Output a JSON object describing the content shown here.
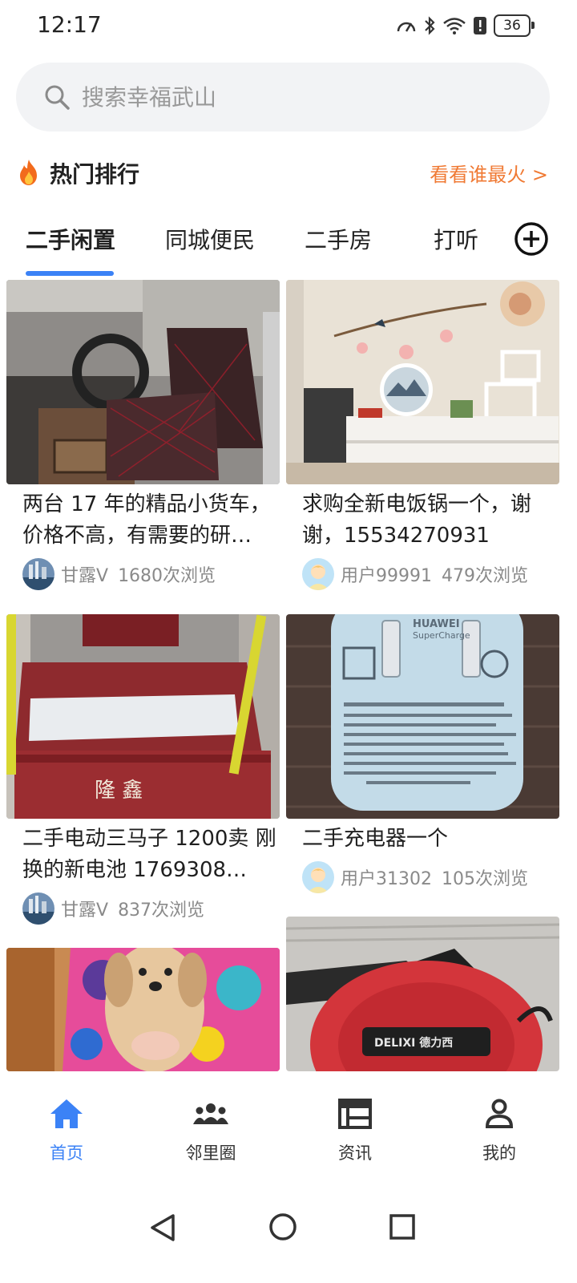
{
  "status": {
    "time": "12:17",
    "battery": "36"
  },
  "search": {
    "placeholder": "搜索幸福武山"
  },
  "hot": {
    "title": "热门排行",
    "link": "看看谁最火 >"
  },
  "tabs": [
    "二手闲置",
    "同城便民",
    "二手房",
    "打听"
  ],
  "cards": [
    {
      "title": "两台 17 年的精品小货车，价格不高，有需要的研…",
      "user": "甘露V",
      "views": "1680次浏览",
      "image": "van-seat-photo",
      "avatar": "city-avatar"
    },
    {
      "title": "求购全新电饭锅一个，谢谢，15534270931",
      "user": "用户99991",
      "views": "479次浏览",
      "image": "tv-wall-photo",
      "avatar": "default-avatar"
    },
    {
      "title": "二手电动三马子 1200卖 刚换的新电池 1769308…",
      "user": "甘露V",
      "views": "837次浏览",
      "image": "tricycle-photo",
      "avatar": "city-avatar"
    },
    {
      "title": "二手充电器一个",
      "user": "用户31302",
      "views": "105次浏览",
      "image": "charger-photo",
      "avatar": "default-avatar"
    },
    {
      "title": "",
      "user": "",
      "views": "",
      "image": "puppy-photo"
    },
    {
      "title": "",
      "user": "",
      "views": "",
      "image": "saw-photo"
    }
  ],
  "charger_label": {
    "brand": "HUAWEI",
    "sub": "SuperCharge"
  },
  "tricycle_label": "隆 鑫",
  "saw_label": "DELIXI 德力西",
  "nav": [
    {
      "label": "首页",
      "icon": "home-icon",
      "active": true
    },
    {
      "label": "邻里圈",
      "icon": "people-icon",
      "active": false
    },
    {
      "label": "资讯",
      "icon": "news-icon",
      "active": false
    },
    {
      "label": "我的",
      "icon": "profile-icon",
      "active": false
    }
  ],
  "colors": {
    "accent": "#3b82f6",
    "hot": "#f07a34"
  }
}
